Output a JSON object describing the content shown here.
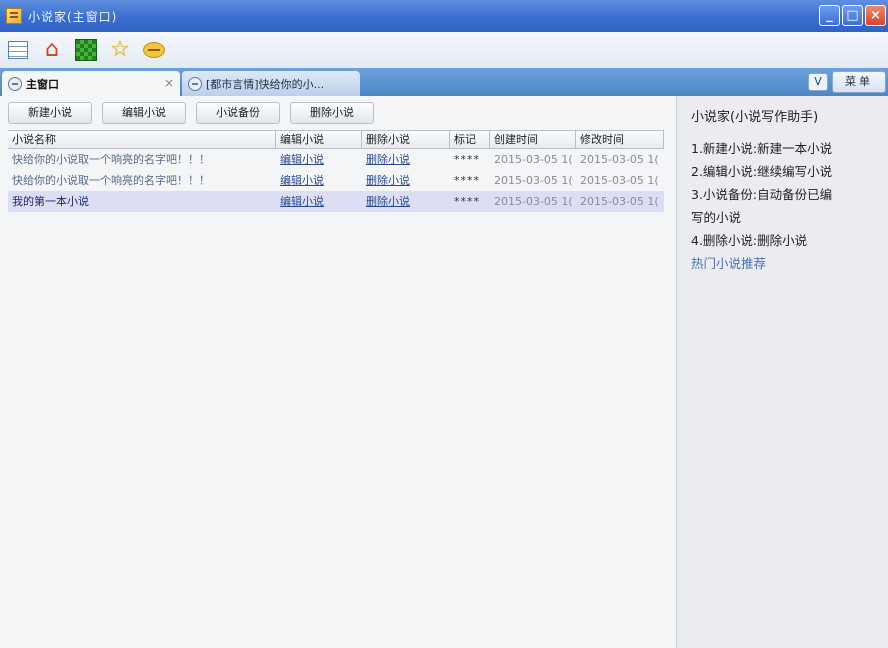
{
  "window": {
    "title": "小说家(主窗口)"
  },
  "toolbar": {
    "icons": [
      "list-icon",
      "home-icon",
      "green-grid-icon",
      "star-icon",
      "chat-icon"
    ]
  },
  "tabs": {
    "active_label": "主窗口",
    "active_close": "×",
    "inactive_label": "[都市言情]快给你的小...",
    "dropdown_label": "V",
    "menu_label": "菜单"
  },
  "actions": {
    "new": "新建小说",
    "edit": "编辑小说",
    "backup": "小说备份",
    "delete": "删除小说"
  },
  "table": {
    "headers": [
      "小说名称",
      "编辑小说",
      "删除小说",
      "标记",
      "创建时间",
      "修改时间"
    ],
    "rows": [
      {
        "name": "快给你的小说取一个响亮的名字吧！！！",
        "edit": "编辑小说",
        "delete": "删除小说",
        "mark": "****",
        "created": "2015-03-05 1(",
        "modified": "2015-03-05 1("
      },
      {
        "name": "快给你的小说取一个响亮的名字吧！！！",
        "edit": "编辑小说",
        "delete": "删除小说",
        "mark": "****",
        "created": "2015-03-05 1(",
        "modified": "2015-03-05 1("
      },
      {
        "name": "我的第一本小说",
        "edit": "编辑小说",
        "delete": "删除小说",
        "mark": "****",
        "created": "2015-03-05 1(",
        "modified": "2015-03-05 1("
      }
    ]
  },
  "sidebar": {
    "title": "小说家(小说写作助手)",
    "items": [
      "1.新建小说:新建一本小说",
      "2.编辑小说:继续编写小说",
      "3.小说备份:自动备份已编",
      "写的小说",
      "4.删除小说:删除小说"
    ],
    "link": "热门小说推荐"
  },
  "colors": {
    "titlebar": "#3a6fd0",
    "tabstrip": "#5a93d2",
    "selected_row": "#dcdff3",
    "link": "#2b4a96",
    "sidebar_link": "#4a70b8"
  }
}
